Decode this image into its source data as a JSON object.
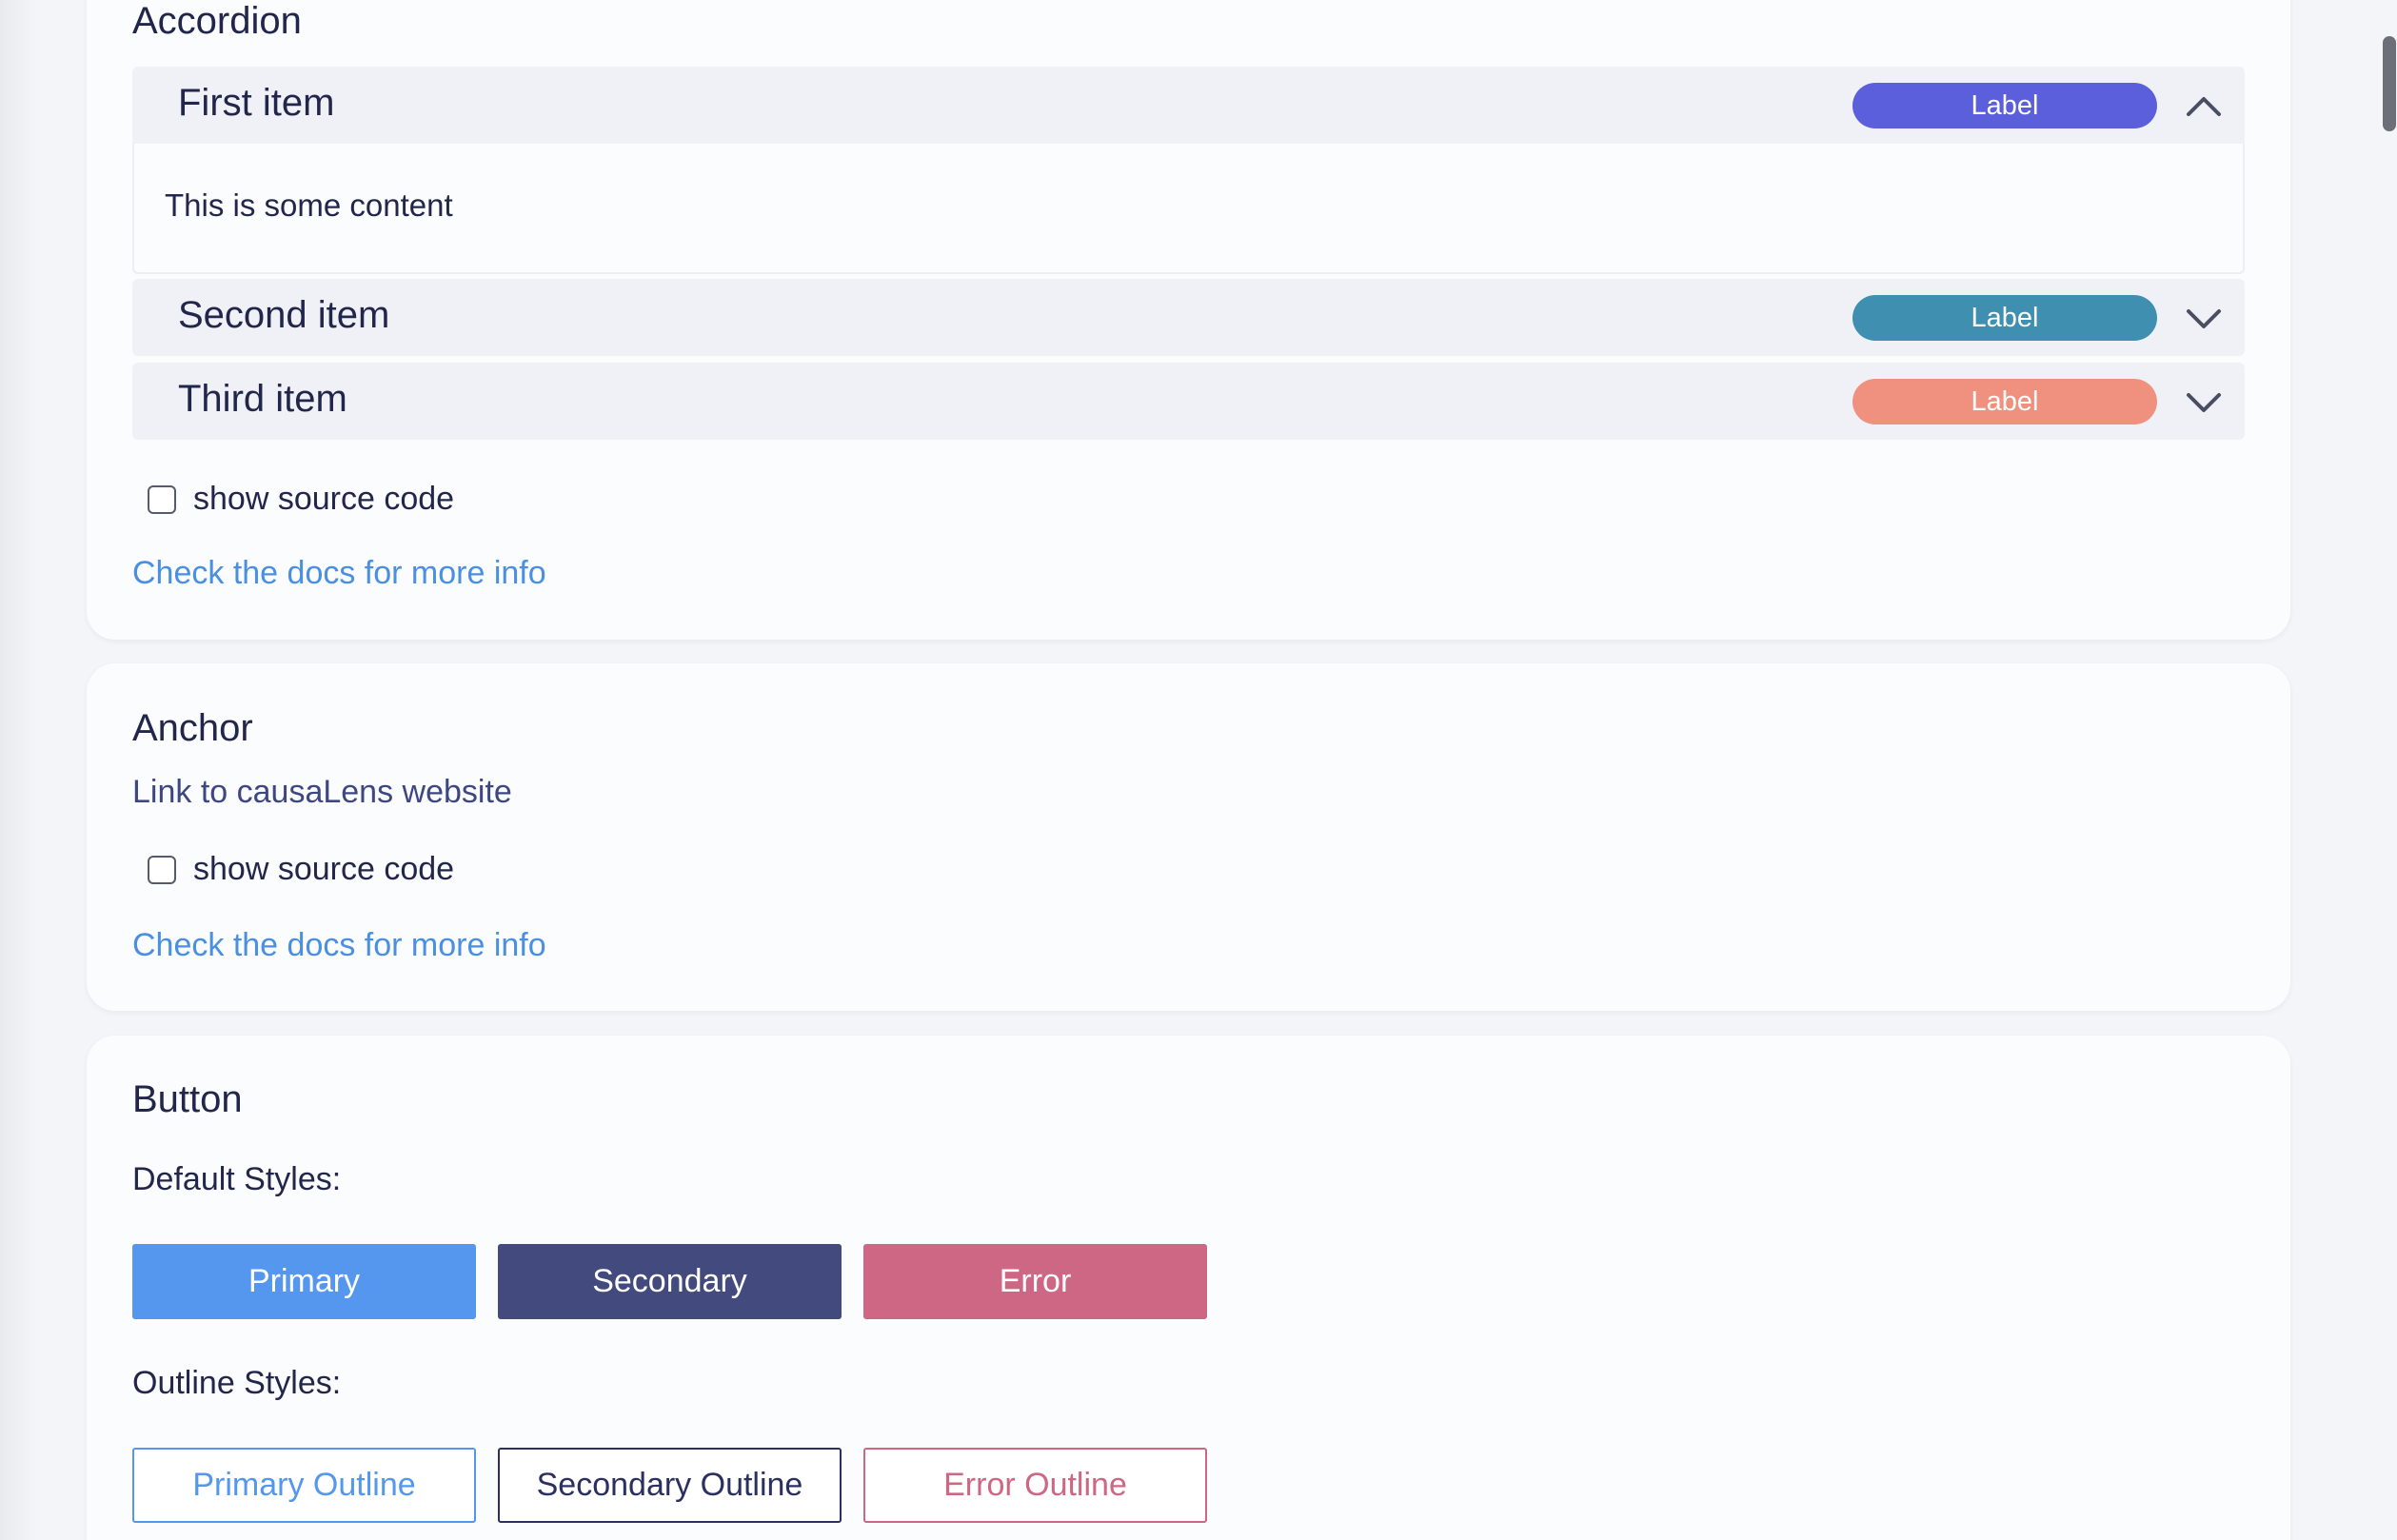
{
  "accordion": {
    "title": "Accordion",
    "items": [
      {
        "title": "First item",
        "badge": "Label",
        "badge_color": "#5b5fdb",
        "expanded": true,
        "content": "This is some content"
      },
      {
        "title": "Second item",
        "badge": "Label",
        "badge_color": "#3f8fb0",
        "expanded": false
      },
      {
        "title": "Third item",
        "badge": "Label",
        "badge_color": "#f0917f",
        "expanded": false
      }
    ],
    "show_source": "show source code",
    "docs_link": "Check the docs for more info"
  },
  "anchor": {
    "title": "Anchor",
    "link_text": "Link to causaLens website",
    "show_source": "show source code",
    "docs_link": "Check the docs for more info"
  },
  "button_section": {
    "title": "Button",
    "default_label": "Default Styles:",
    "outline_label": "Outline Styles:",
    "default_buttons": [
      {
        "label": "Primary",
        "color": "#5597ee"
      },
      {
        "label": "Secondary",
        "color": "#434a7d"
      },
      {
        "label": "Error",
        "color": "#cd6783"
      }
    ],
    "outline_buttons": [
      {
        "label": "Primary Outline",
        "color": "#5597ee"
      },
      {
        "label": "Secondary Outline",
        "color": "#2b3060"
      },
      {
        "label": "Error Outline",
        "color": "#cd6783"
      }
    ]
  },
  "icons": {
    "expanded": "chevron-up-icon",
    "collapsed": "chevron-down-icon",
    "checkbox": "checkbox-icon"
  }
}
